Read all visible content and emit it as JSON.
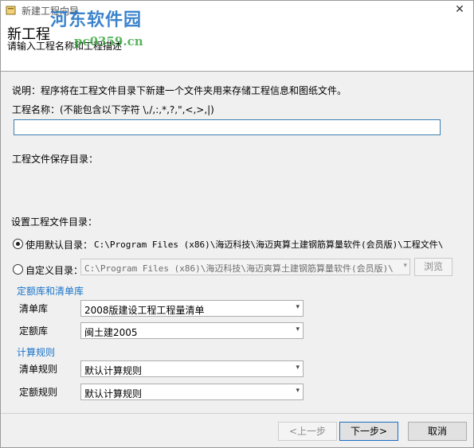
{
  "window": {
    "title": "新建工程向导",
    "close_glyph": "✕"
  },
  "watermark": {
    "text": "河东软件园",
    "url": "pc0359.cn"
  },
  "header": {
    "title": "新工程",
    "description": "请输入工程名称和工程描述"
  },
  "note": "说明：程序将在工程文件目录下新建一个文件夹用来存储工程信息和图纸文件。",
  "project_name": {
    "label": "工程名称：(不能包含以下字符 \\,/,:,*,?,\",<,>,|)",
    "value": ""
  },
  "save_dir_label": "工程文件保存目录：",
  "dir_section": {
    "label": "设置工程文件目录：",
    "default_option": {
      "label": "使用默认目录：",
      "path": "C:\\Program Files (x86)\\海迈科技\\海迈爽算土建钢筋算量软件(会员版)\\工程文件\\",
      "selected": true
    },
    "custom_option": {
      "label": "自定义目录：",
      "path": "C:\\Program Files (x86)\\海迈科技\\海迈爽算土建钢筋算量软件(会员版)\\",
      "selected": false
    },
    "browse_label": "浏览"
  },
  "quota_section": {
    "title": "定额库和清单库",
    "list_label": "清单库",
    "list_value": "2008版建设工程工程量清单",
    "quota_label": "定额库",
    "quota_value": "闽土建2005"
  },
  "rules_section": {
    "title": "计算规则",
    "list_rule_label": "清单规则",
    "list_rule_value": "默认计算规则",
    "quota_rule_label": "定额规则",
    "quota_rule_value": "默认计算规则"
  },
  "buttons": {
    "prev": "<上一步",
    "next": "下一步>",
    "cancel": "取消"
  },
  "icons": {
    "dropdown": "▾",
    "app": "wizard-icon"
  },
  "colors": {
    "accent": "#1a74c9",
    "input_border": "#3c7fb1"
  }
}
